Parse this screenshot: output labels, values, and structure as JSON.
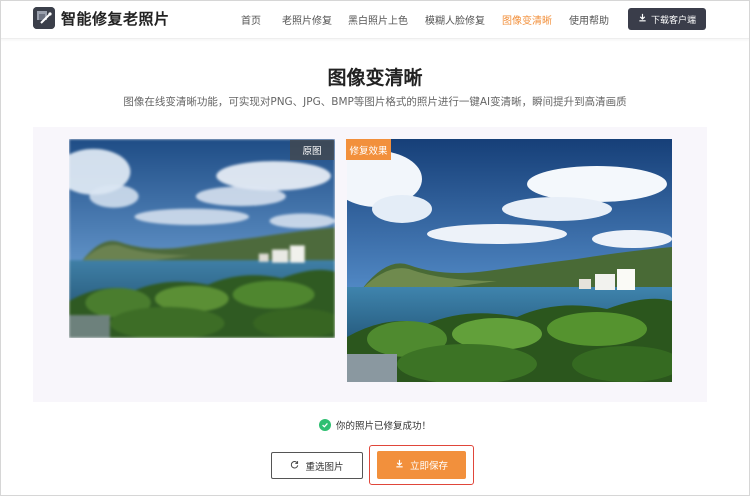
{
  "app": {
    "title": "智能修复老照片",
    "logo_icon": "photo-restore-logo-icon"
  },
  "nav": {
    "items": [
      {
        "label": "首页",
        "active": false
      },
      {
        "label": "老照片修复",
        "active": false
      },
      {
        "label": "黑白照片上色",
        "active": false
      },
      {
        "label": "模糊人脸修复",
        "active": false
      },
      {
        "label": "图像变清晰",
        "active": true
      },
      {
        "label": "使用帮助",
        "active": false
      }
    ],
    "download_label": "下载客户端",
    "download_icon": "download-icon"
  },
  "hero": {
    "title": "图像变清晰",
    "subtitle": "图像在线变清晰功能，可实现对PNG、JPG、BMP等图片格式的照片进行一键AI变清晰，瞬间提升到高清画质"
  },
  "compare": {
    "original_tag": "原图",
    "enhanced_tag": "修复效果"
  },
  "status": {
    "success_text": "你的照片已修复成功！",
    "icon": "check-circle-icon"
  },
  "actions": {
    "reselect_label": "重选图片",
    "reselect_icon": "refresh-icon",
    "save_label": "立即保存",
    "save_icon": "download-icon"
  },
  "colors": {
    "accent": "#f2903c",
    "dark_button": "#3a3d4a",
    "success": "#2fbf71",
    "highlight_border": "#e0463a",
    "panel_bg": "#f8f6fb"
  }
}
